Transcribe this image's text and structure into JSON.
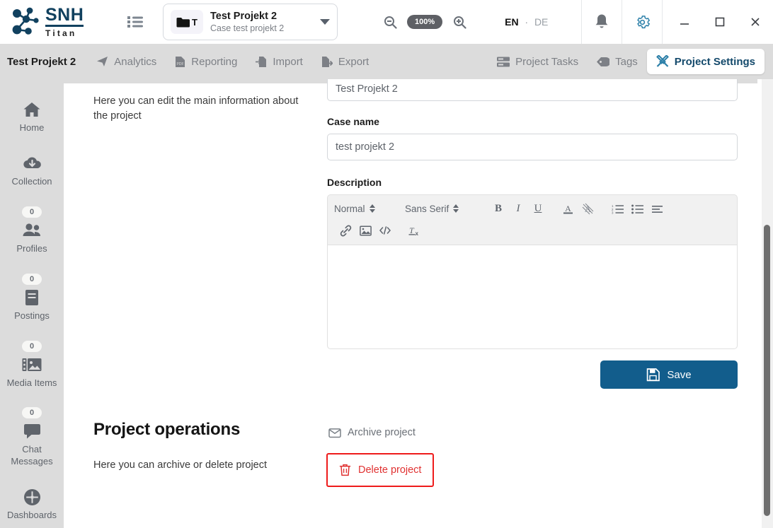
{
  "header": {
    "logo_primary": "SNH",
    "logo_secondary": "Titan",
    "list_icon": "list-icon",
    "project": {
      "badge_letter": "T",
      "title": "Test Projekt 2",
      "subtitle": "Case test projekt 2"
    },
    "zoom": {
      "out_icon": "zoom-out-icon",
      "level": "100%",
      "in_icon": "zoom-in-icon"
    },
    "language": {
      "active": "EN",
      "separator": "·",
      "inactive": "DE"
    },
    "notifications_icon": "bell-icon",
    "settings_icon": "gear-icon",
    "window": {
      "minimize": "minimize-icon",
      "maximize": "maximize-icon",
      "close": "close-icon"
    }
  },
  "nav": {
    "project_name": "Test Projekt 2",
    "tabs": [
      {
        "label": "Analytics",
        "icon": "analytics-icon",
        "active": false
      },
      {
        "label": "Reporting",
        "icon": "pdf-report-icon",
        "active": false
      },
      {
        "label": "Import",
        "icon": "import-icon",
        "active": false
      },
      {
        "label": "Export",
        "icon": "export-icon",
        "active": false
      },
      {
        "label": "Project Tasks",
        "icon": "tasks-icon",
        "active": false
      },
      {
        "label": "Tags",
        "icon": "tag-icon",
        "active": false
      },
      {
        "label": "Project Settings",
        "icon": "tools-icon",
        "active": true
      }
    ]
  },
  "sidebar": {
    "items": [
      {
        "label": "Home",
        "icon": "home-icon",
        "badge": null
      },
      {
        "label": "Collection",
        "icon": "cloud-down-icon",
        "badge": null
      },
      {
        "label": "Profiles",
        "icon": "people-icon",
        "badge": "0"
      },
      {
        "label": "Postings",
        "icon": "book-icon",
        "badge": "0"
      },
      {
        "label": "Media Items",
        "icon": "media-icon",
        "badge": "0"
      },
      {
        "label": "Chat Messages",
        "icon": "chat-icon",
        "badge": "0"
      },
      {
        "label": "Dashboards",
        "icon": "gauge-icon",
        "badge": null
      }
    ]
  },
  "main": {
    "info_section": {
      "description": "Here you can edit the main information about the project",
      "project_name_value": "Test Projekt 2",
      "case_name_label": "Case name",
      "case_name_value": "test projekt 2",
      "description_label": "Description",
      "description_value": "",
      "editor": {
        "block_format": "Normal",
        "font_family": "Sans Serif",
        "buttons": [
          {
            "name": "bold-icon",
            "glyph": "B"
          },
          {
            "name": "italic-icon",
            "glyph": "I"
          },
          {
            "name": "underline-icon",
            "glyph": "U"
          },
          {
            "name": "text-color-icon",
            "glyph": "A"
          },
          {
            "name": "highlight-icon",
            "glyph": "A"
          },
          {
            "name": "ordered-list-icon",
            "glyph": ""
          },
          {
            "name": "bullet-list-icon",
            "glyph": ""
          },
          {
            "name": "align-icon",
            "glyph": ""
          },
          {
            "name": "link-icon",
            "glyph": ""
          },
          {
            "name": "image-icon",
            "glyph": ""
          },
          {
            "name": "code-icon",
            "glyph": ""
          },
          {
            "name": "clear-format-icon",
            "glyph": ""
          }
        ]
      },
      "save_label": "Save",
      "save_icon": "floppy-disk-icon"
    },
    "operations_section": {
      "title": "Project operations",
      "description": "Here you can archive or delete project",
      "archive_label": "Archive project",
      "archive_icon": "archive-icon",
      "delete_label": "Delete project",
      "delete_icon": "trash-icon"
    }
  },
  "colors": {
    "brand_dark": "#11415f",
    "accent_blue": "#125d8c",
    "danger_red": "#e03131",
    "danger_border": "#ee1b1b",
    "nav_bg": "#dcdcdc",
    "sidebar_bg": "#dcdcdc"
  }
}
